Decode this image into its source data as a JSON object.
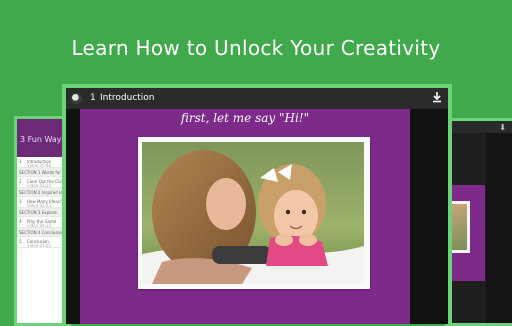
{
  "headline": "Learn How to Unlock Your Creativity",
  "main_window": {
    "lesson_number": "1",
    "lesson_title": "Introduction",
    "slide_caption": "first, let me say \"Hi!\""
  },
  "left_window": {
    "course_title": "3 Fun Ways to",
    "rows": [
      {
        "type": "lesson",
        "num": "1",
        "title": "Introduction",
        "sub": "Video 00:48"
      },
      {
        "type": "section",
        "title": "SECTION 1  Words for Art"
      },
      {
        "type": "lesson",
        "num": "2",
        "title": "Clear Out the Clutter",
        "sub": "Video 03:20"
      },
      {
        "type": "section",
        "title": "SECTION 2  Inspired Ideas"
      },
      {
        "type": "lesson",
        "num": "3",
        "title": "How Many Ideas?",
        "sub": "Video 02:45"
      },
      {
        "type": "section",
        "title": "SECTION 3  Explore"
      },
      {
        "type": "lesson",
        "num": "4",
        "title": "Play the Game",
        "sub": "Video 04:10"
      },
      {
        "type": "section",
        "title": "SECTION 4  Conclusion"
      },
      {
        "type": "lesson",
        "num": "5",
        "title": "Conclusion",
        "sub": "Video 01:05"
      }
    ]
  },
  "icons": {
    "app": "app-logo-icon",
    "download": "download-icon"
  },
  "colors": {
    "background": "#3fa94b",
    "device_border": "#6dd37a",
    "slide_purple": "#7d2a8a",
    "topbar": "#2b2b2b"
  }
}
